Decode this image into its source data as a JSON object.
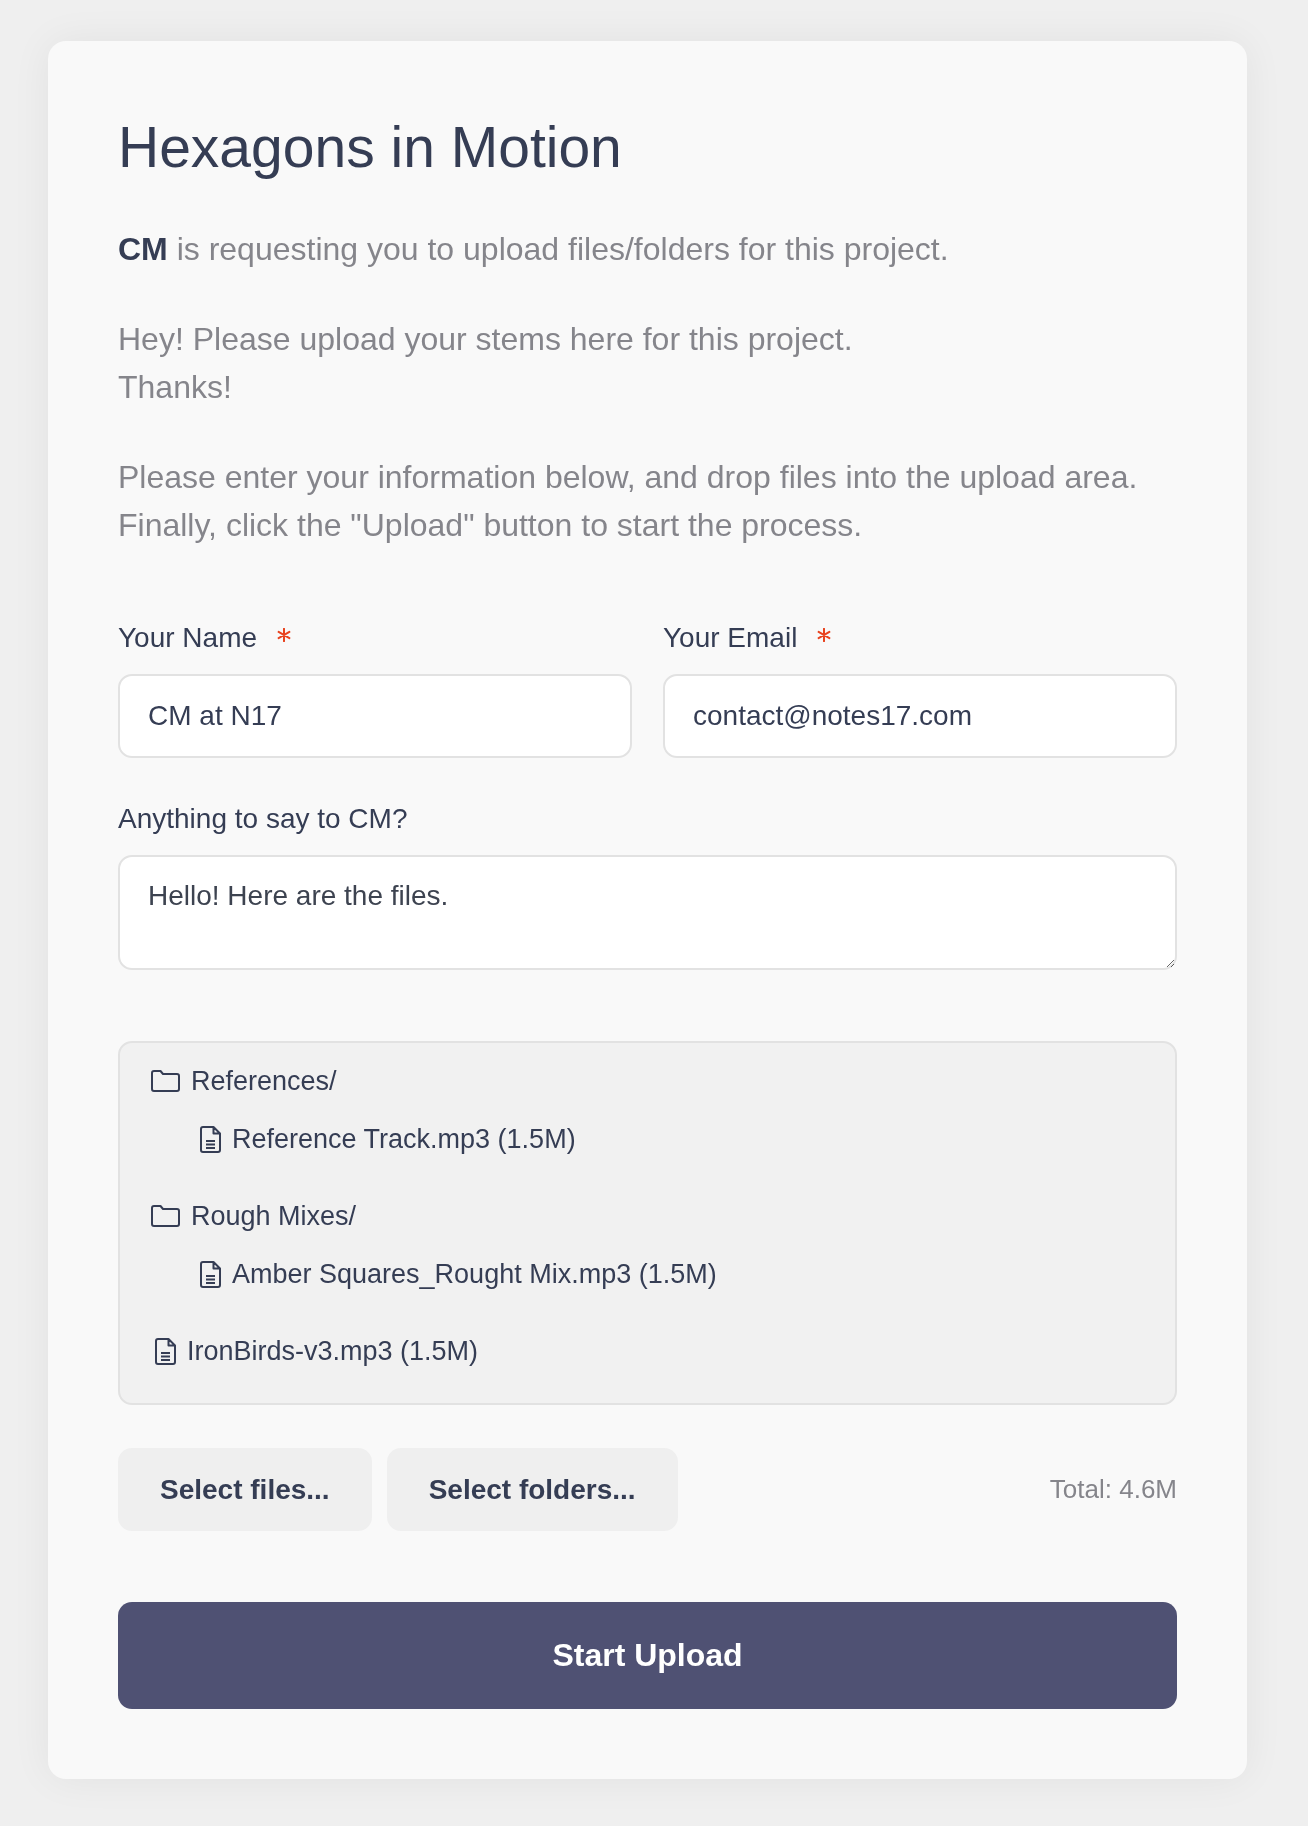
{
  "title": "Hexagons in Motion",
  "intro": "**CM** is requesting you to upload files/folders for this project.",
  "message": [
    "Hey! Please upload your stems here for this project.",
    "Thanks!"
  ],
  "instructions": [
    "Please enter your information below, and drop files into the upload area.",
    "Finally, click the \"Upload\" button to start the process."
  ],
  "fields": [
    {
      "kind": "text",
      "label": "Your Name",
      "required": true,
      "value": "CM at N17"
    },
    {
      "kind": "text",
      "label": "Your Email",
      "required": true,
      "value": "contact@notes17.com"
    },
    {
      "kind": "textarea",
      "label": "Anything to say to CM?",
      "required": false,
      "value": "Hello! Here are the files."
    }
  ],
  "files": [
    {
      "kind": "folder",
      "name": "References/",
      "children": [
        {
          "kind": "file",
          "name": "Reference Track.mp3 (1.5M)"
        }
      ]
    },
    {
      "kind": "folder",
      "name": "Rough Mixes/",
      "children": [
        {
          "kind": "file",
          "name": "Amber Squares_Rought Mix.mp3 (1.5M)"
        }
      ]
    },
    {
      "kind": "file",
      "name": "IronBirds-v3.mp3 (1.5M)"
    }
  ],
  "select_buttons": [
    "Select files...",
    "Select folders..."
  ],
  "total": "Total: 4.6M",
  "submit_button": "Start Upload"
}
